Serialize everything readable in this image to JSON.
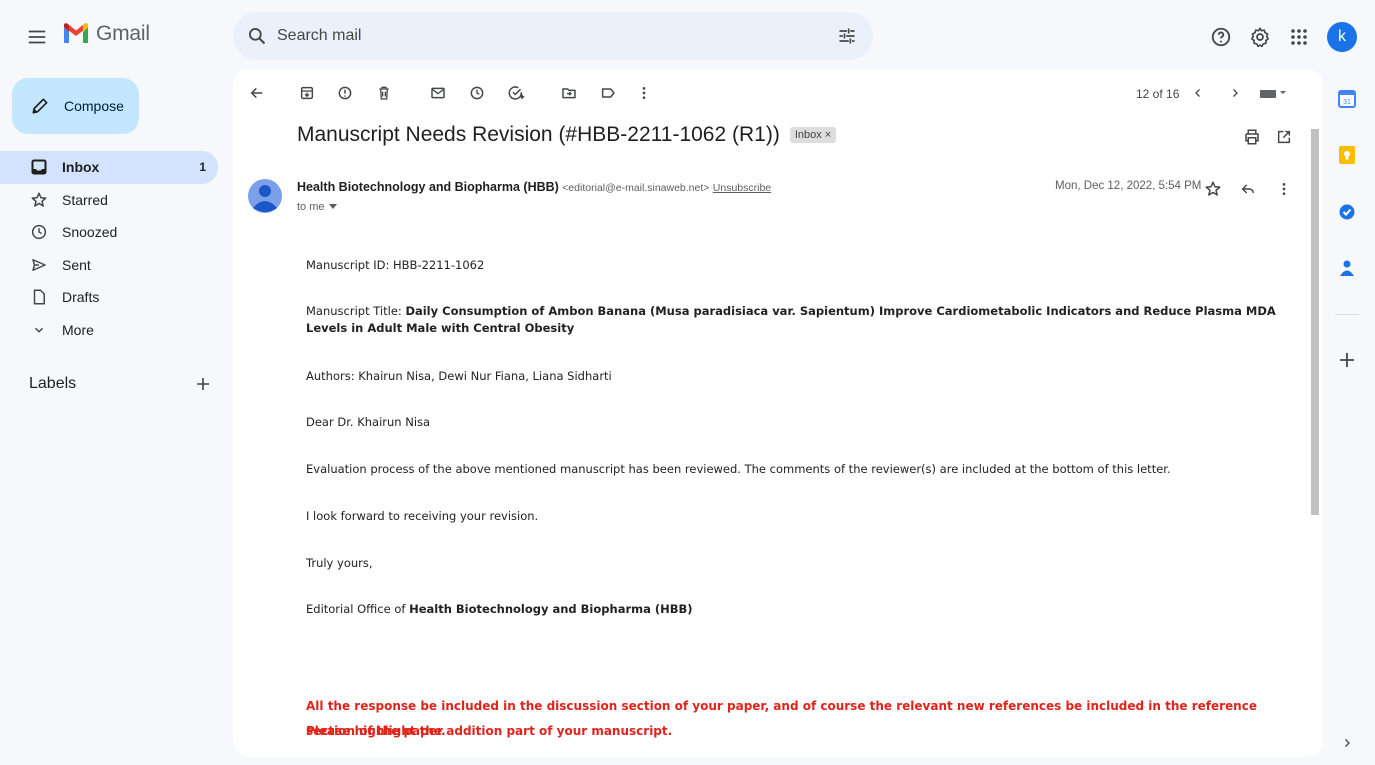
{
  "header": {
    "app_name": "Gmail",
    "search_placeholder": "Search mail",
    "avatar_letter": "k"
  },
  "sidebar": {
    "compose_label": "Compose",
    "items": [
      {
        "label": "Inbox",
        "count": "1",
        "icon": "inbox-icon"
      },
      {
        "label": "Starred",
        "count": "",
        "icon": "star-icon"
      },
      {
        "label": "Snoozed",
        "count": "",
        "icon": "clock-icon"
      },
      {
        "label": "Sent",
        "count": "",
        "icon": "send-icon"
      },
      {
        "label": "Drafts",
        "count": "",
        "icon": "draft-icon"
      },
      {
        "label": "More",
        "count": "",
        "icon": "chevron-down-icon"
      }
    ],
    "labels_title": "Labels"
  },
  "toolbar": {
    "pager": "12 of 16"
  },
  "email": {
    "subject": "Manuscript Needs Revision (#HBB-2211-1062 (R1))",
    "label_badge": "Inbox",
    "sender_name": "Health Biotechnology and Biopharma (HBB)",
    "sender_email": "<editorial@e-mail.sinaweb.net>",
    "unsubscribe": "Unsubscribe",
    "to": "to me",
    "date": "Mon, Dec 12, 2022, 5:54 PM",
    "body": {
      "manuscript_id": "Manuscript ID: HBB-2211-1062",
      "title_prefix": "Manuscript Title: ",
      "title_bold": "Daily Consumption of Ambon Banana (Musa paradisiaca var. Sapientum) Improve Cardiometabolic Indicators and Reduce Plasma MDA Levels in Adult Male with Central Obesity",
      "authors": "Authors: Khairun Nisa, Dewi Nur Fiana, Liana Sidharti",
      "greeting": "Dear Dr. Khairun Nisa",
      "evaluation": "Evaluation process of the above mentioned manuscript has been reviewed. The comments of the reviewer(s) are included at the bottom of this letter.",
      "forward": "I look forward to receiving your revision.",
      "closing": "Truly yours,",
      "sig_prefix": "Editorial Office of ",
      "sig_bold": "Health Biotechnology and Biopharma (HBB)",
      "red_line_1": "All the response be included in the discussion section of your paper, and of course the relevant new references be included in the reference section of the paper.",
      "red_line_2": "Please highlight the addition part of your manuscript."
    }
  },
  "colors": {
    "accent": "#0b57d0",
    "compose_bg": "#c2e7ff",
    "active_nav": "#d3e3fd",
    "red_text": "#e0241c"
  }
}
